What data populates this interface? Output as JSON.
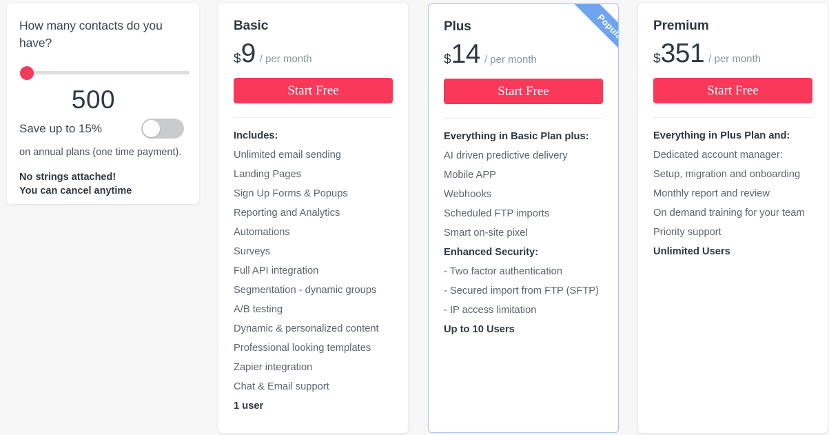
{
  "theme": {
    "page_background": "#f7f7f7",
    "cta_color": "#f9385a",
    "slider_thumb_color": "#f23a5c",
    "ribbon_color": "#6fa4ef",
    "plus_border_color": "#a8c6ef",
    "text_color": "#2e3742",
    "muted_text_color": "#5c636d"
  },
  "calculator": {
    "question": "How many contacts do you have?",
    "slider": {
      "value": 500,
      "position_percent": 0
    },
    "contact_count": "500",
    "save_label": "Save up to 15%",
    "toggle": {
      "state": "off",
      "name": "annual-billing-toggle"
    },
    "annual_note": "on annual plans (one time payment).",
    "no_strings_line1": "No strings attached!",
    "no_strings_line2": "You can cancel anytime"
  },
  "plans": [
    {
      "id": "basic",
      "name": "Basic",
      "currency": "$",
      "amount": "9",
      "period": "/ per month",
      "cta_label": "Start Free",
      "badge": null,
      "features": [
        {
          "text": "Includes:",
          "bold": true
        },
        {
          "text": "Unlimited email sending",
          "bold": false
        },
        {
          "text": "Landing Pages",
          "bold": false
        },
        {
          "text": "Sign Up Forms & Popups",
          "bold": false
        },
        {
          "text": "Reporting and Analytics",
          "bold": false
        },
        {
          "text": "Automations",
          "bold": false
        },
        {
          "text": "Surveys",
          "bold": false
        },
        {
          "text": "Full API integration",
          "bold": false
        },
        {
          "text": "Segmentation - dynamic groups",
          "bold": false
        },
        {
          "text": "A/B testing",
          "bold": false
        },
        {
          "text": "Dynamic & personalized content",
          "bold": false
        },
        {
          "text": "Professional looking templates",
          "bold": false
        },
        {
          "text": "Zapier integration",
          "bold": false
        },
        {
          "text": "Chat & Email support",
          "bold": false
        },
        {
          "text": "1 user",
          "bold": true
        }
      ]
    },
    {
      "id": "plus",
      "name": "Plus",
      "currency": "$",
      "amount": "14",
      "period": "/ per month",
      "cta_label": "Start Free",
      "badge": "Popular",
      "features": [
        {
          "text": "Everything in Basic Plan plus:",
          "bold": true
        },
        {
          "text": "AI driven predictive delivery",
          "bold": false
        },
        {
          "text": "Mobile APP",
          "bold": false
        },
        {
          "text": "Webhooks",
          "bold": false
        },
        {
          "text": "Scheduled FTP imports",
          "bold": false
        },
        {
          "text": "Smart on-site pixel",
          "bold": false
        },
        {
          "text": "Enhanced Security:",
          "bold": true
        },
        {
          "text": "- Two factor authentication",
          "bold": false
        },
        {
          "text": "- Secured import from FTP (SFTP)",
          "bold": false
        },
        {
          "text": "- IP access limitation",
          "bold": false
        },
        {
          "text": "Up to 10 Users",
          "bold": true
        }
      ]
    },
    {
      "id": "premium",
      "name": "Premium",
      "currency": "$",
      "amount": "351",
      "period": "/ per month",
      "cta_label": "Start Free",
      "badge": null,
      "features": [
        {
          "text": "Everything in Plus Plan and:",
          "bold": true
        },
        {
          "text": "Dedicated account manager:",
          "bold": false
        },
        {
          "text": "Setup, migration and onboarding",
          "bold": false
        },
        {
          "text": "Monthly report and review",
          "bold": false
        },
        {
          "text": "On demand training for your team",
          "bold": false
        },
        {
          "text": "Priority support",
          "bold": false
        },
        {
          "text": "Unlimited Users",
          "bold": true
        }
      ]
    }
  ]
}
